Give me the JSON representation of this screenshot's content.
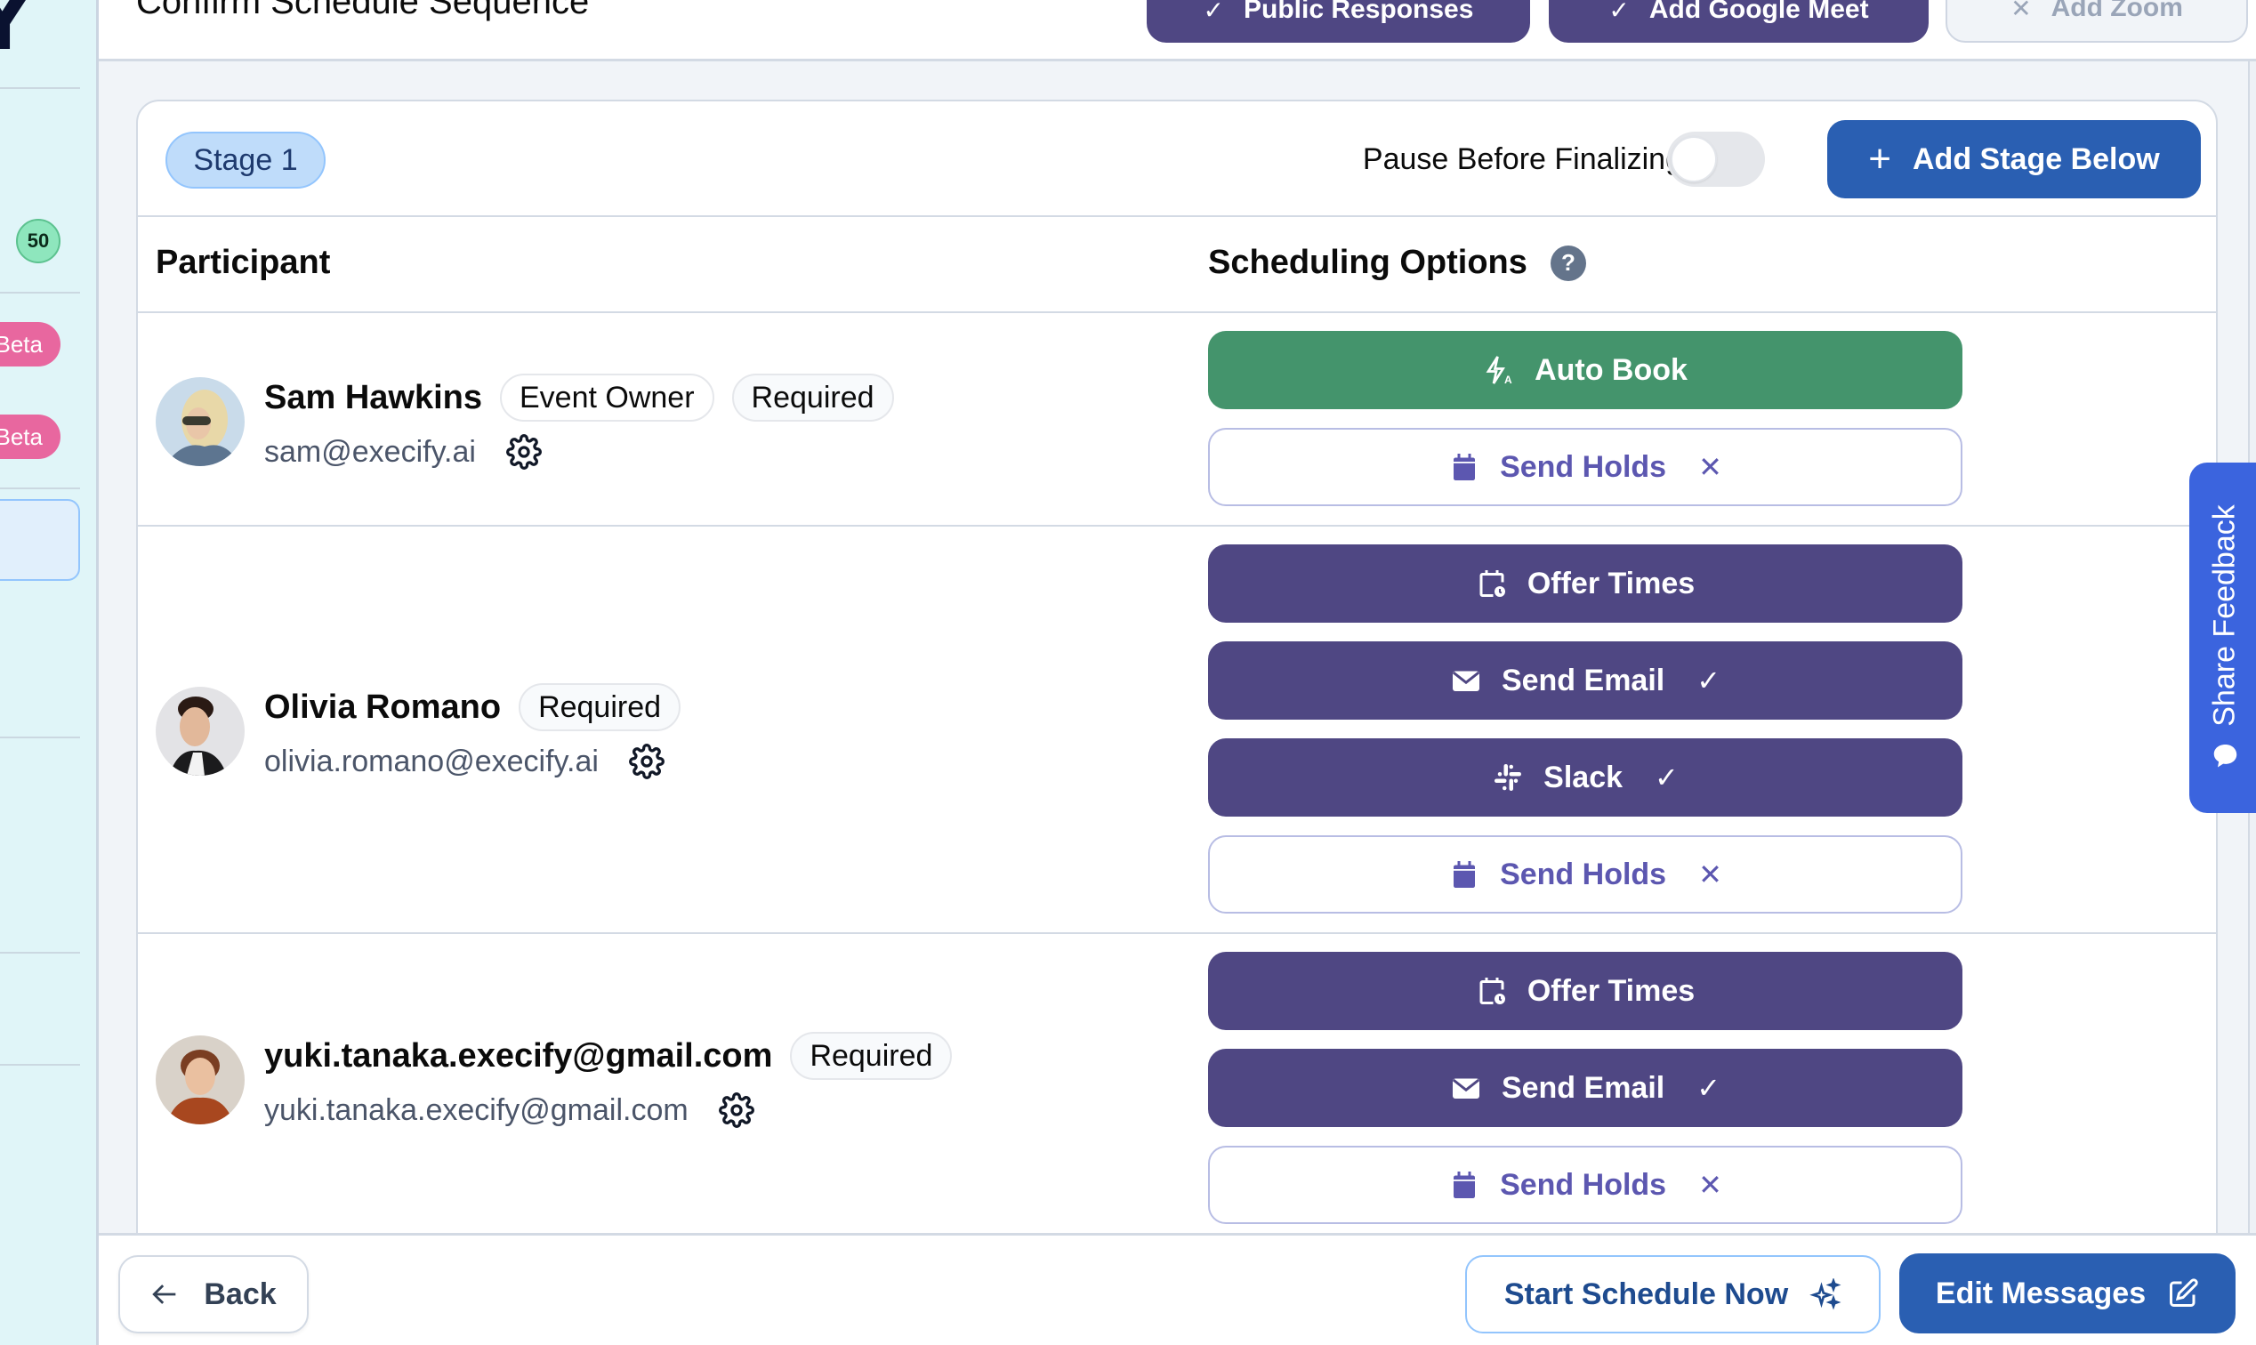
{
  "sidebar": {
    "logo_letter": "Y",
    "credits_badge": "50",
    "beta_badges": [
      "Beta",
      "Beta"
    ]
  },
  "header": {
    "title": "Confirm Schedule Sequence",
    "buttons": [
      {
        "label": "Public Responses",
        "state_icon": "✓",
        "enabled": true
      },
      {
        "label": "Add Google Meet",
        "state_icon": "✓",
        "enabled": true
      },
      {
        "label": "Add Zoom",
        "state_icon": "✕",
        "enabled": false
      }
    ]
  },
  "stage": {
    "label": "Stage 1",
    "pause_label": "Pause Before Finalizing",
    "pause_enabled": false,
    "add_stage_label": "Add Stage Below"
  },
  "table": {
    "col_participant": "Participant",
    "col_scheduling": "Scheduling Options",
    "help_icon": "?"
  },
  "participants": [
    {
      "name": "Sam Hawkins",
      "email": "sam@execify.ai",
      "tags": [
        "Event Owner",
        "Required"
      ],
      "options": [
        {
          "label": "Auto Book",
          "icon": "auto-book-icon",
          "style": "green",
          "mark": ""
        },
        {
          "label": "Send Holds",
          "icon": "calendar-icon",
          "style": "outline",
          "mark": "✕"
        }
      ]
    },
    {
      "name": "Olivia Romano",
      "email": "olivia.romano@execify.ai",
      "tags": [
        "Required"
      ],
      "options": [
        {
          "label": "Offer Times",
          "icon": "calendar-clock-icon",
          "style": "purple",
          "mark": ""
        },
        {
          "label": "Send Email",
          "icon": "envelope-icon",
          "style": "purple",
          "mark": "✓"
        },
        {
          "label": "Slack",
          "icon": "slack-icon",
          "style": "purple",
          "mark": "✓"
        },
        {
          "label": "Send Holds",
          "icon": "calendar-icon",
          "style": "outline",
          "mark": "✕"
        }
      ]
    },
    {
      "name": "yuki.tanaka.execify@gmail.com",
      "email": "yuki.tanaka.execify@gmail.com",
      "tags": [
        "Required"
      ],
      "options": [
        {
          "label": "Offer Times",
          "icon": "calendar-clock-icon",
          "style": "purple",
          "mark": ""
        },
        {
          "label": "Send Email",
          "icon": "envelope-icon",
          "style": "purple",
          "mark": "✓"
        },
        {
          "label": "Send Holds",
          "icon": "calendar-icon",
          "style": "outline",
          "mark": "✕"
        }
      ]
    }
  ],
  "footer": {
    "back_label": "Back",
    "start_label": "Start Schedule Now",
    "edit_label": "Edit Messages"
  },
  "feedback": {
    "label": "Share Feedback"
  },
  "colors": {
    "primary_blue": "#2a5fb2",
    "purple": "#4f4783",
    "green": "#44946c",
    "beta_pink": "#e8679f",
    "feedback_blue": "#3b64de"
  }
}
